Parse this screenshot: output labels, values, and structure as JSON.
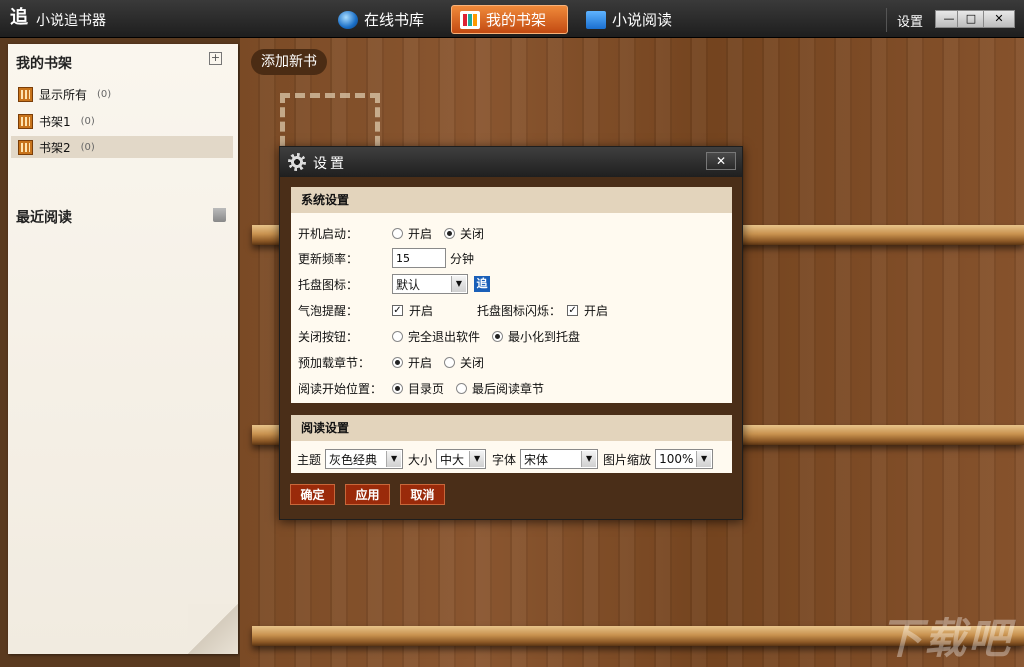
{
  "app": {
    "title": "小说追书器",
    "logo_glyph": "追"
  },
  "nav": {
    "online": "在线书库",
    "shelf": "我的书架",
    "reading": "小说阅读"
  },
  "titlebar": {
    "settings": "设置",
    "minimize": "—",
    "maximize": "□",
    "close": "✕"
  },
  "sidebar": {
    "shelf_heading": "我的书架",
    "recent_heading": "最近阅读",
    "add_icon": "+",
    "items": [
      {
        "label": "显示所有",
        "count": "(0)"
      },
      {
        "label": "书架1",
        "count": "(0)"
      },
      {
        "label": "书架2",
        "count": "(0)"
      }
    ]
  },
  "main": {
    "add_book": "添加新书"
  },
  "dialog": {
    "title": "设置",
    "close": "✕",
    "system": {
      "header": "系统设置",
      "startup": {
        "label": "开机启动：",
        "on": "开启",
        "off": "关闭"
      },
      "frequency": {
        "label": "更新频率：",
        "value": "15",
        "unit": "分钟"
      },
      "tray_icon": {
        "label": "托盘图标：",
        "value": "默认",
        "preview": "追"
      },
      "bubble": {
        "label": "气泡提醒：",
        "on": "开启",
        "flash_label": "托盘图标闪烁：",
        "flash_on": "开启"
      },
      "close_btn": {
        "label": "关闭按钮：",
        "exit": "完全退出软件",
        "minimize": "最小化到托盘"
      },
      "preload": {
        "label": "预加载章节：",
        "on": "开启",
        "off": "关闭"
      },
      "read_start": {
        "label": "阅读开始位置：",
        "toc": "目录页",
        "last": "最后阅读章节"
      }
    },
    "reading": {
      "header": "阅读设置",
      "theme_label": "主题",
      "theme_value": "灰色经典",
      "size_label": "大小",
      "size_value": "中大",
      "font_label": "字体",
      "font_value": "宋体",
      "zoom_label": "图片缩放",
      "zoom_value": "100%"
    },
    "buttons": {
      "ok": "确定",
      "apply": "应用",
      "cancel": "取消"
    },
    "check_mark": "✓",
    "arrow": "▼"
  },
  "watermark": "下载吧"
}
